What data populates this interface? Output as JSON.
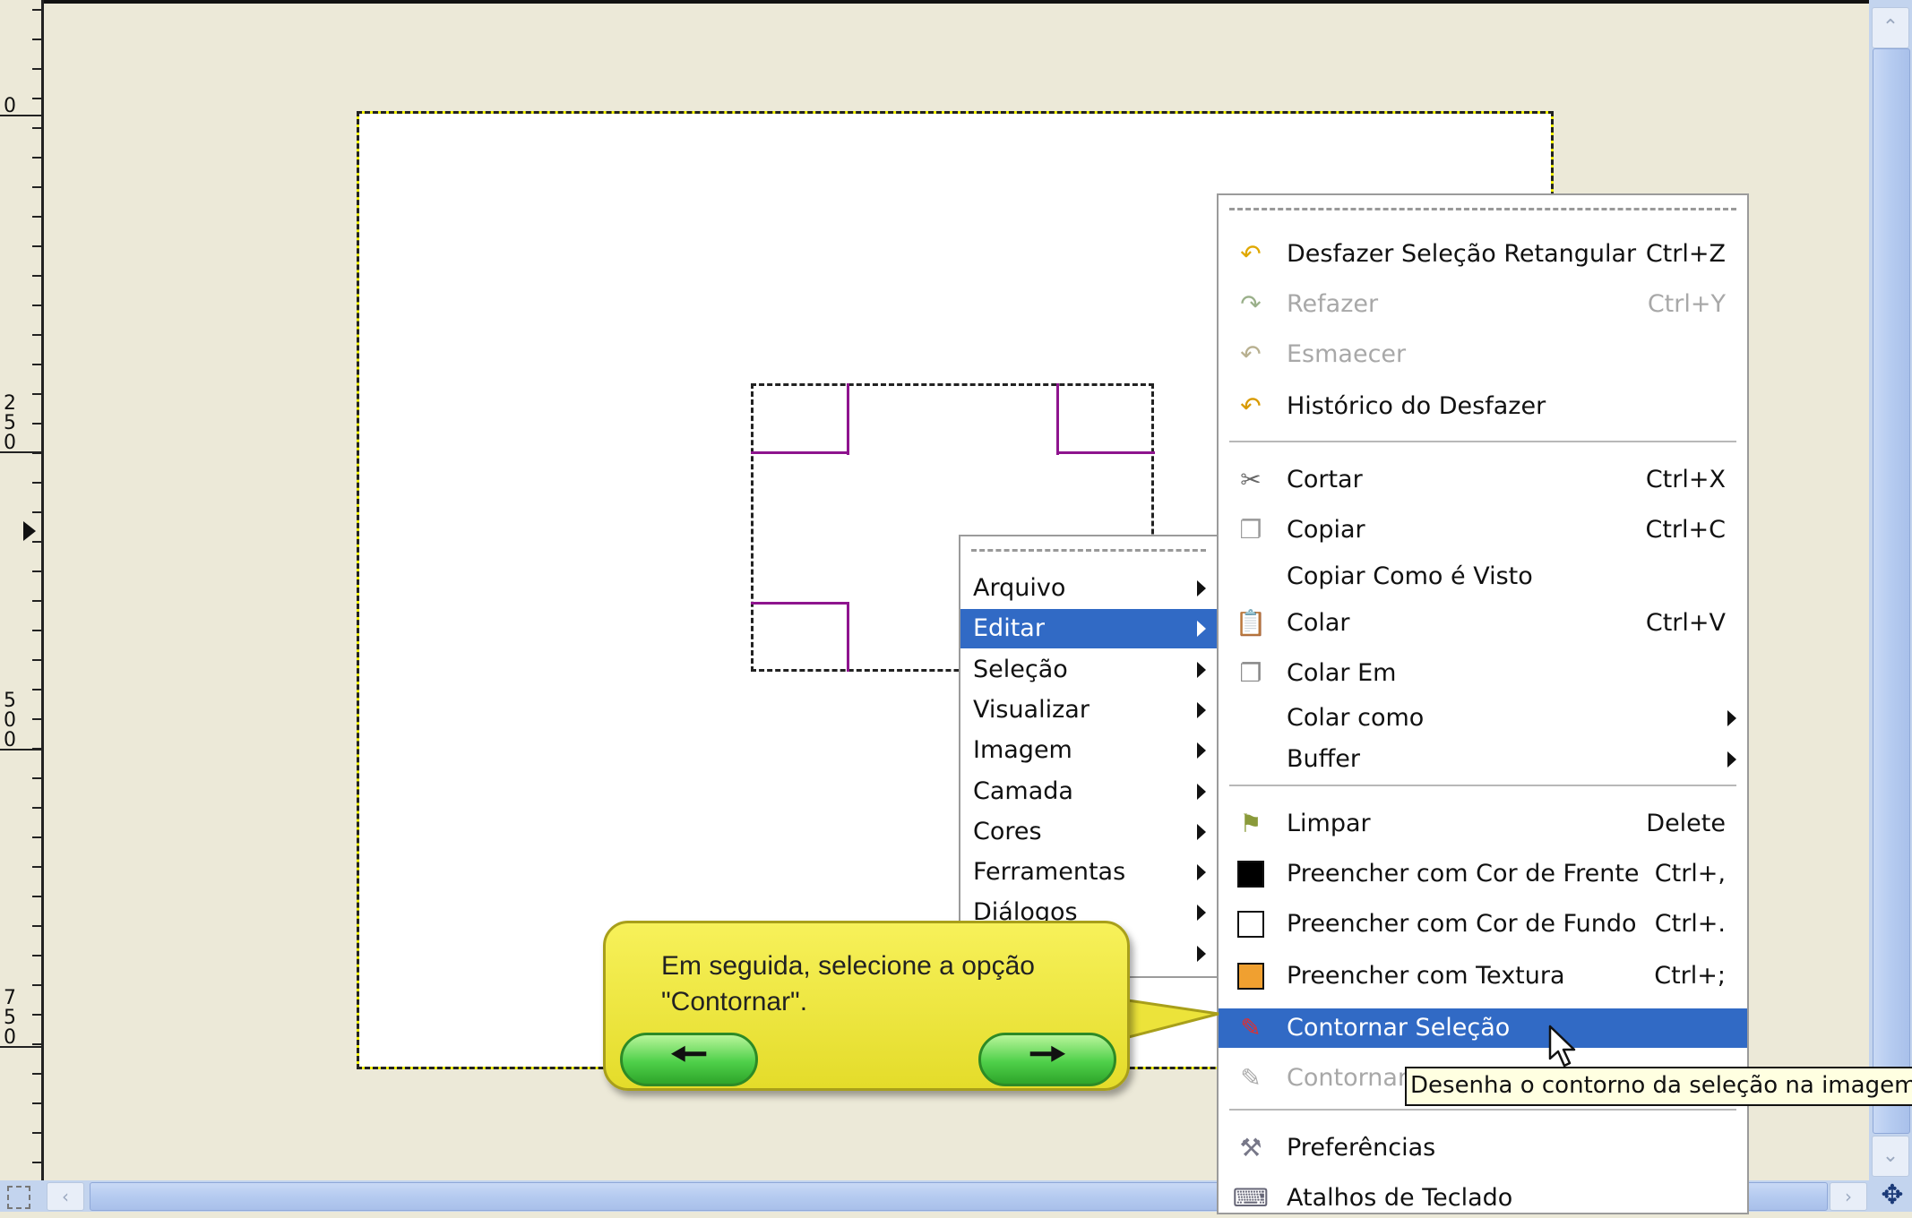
{
  "ruler": {
    "labels": [
      {
        "text": "0",
        "digits": [
          "0"
        ]
      },
      {
        "text": "250",
        "digits": [
          "2",
          "5",
          "0"
        ]
      },
      {
        "text": "500",
        "digits": [
          "5",
          "0",
          "0"
        ]
      },
      {
        "text": "750",
        "digits": [
          "7",
          "5",
          "0"
        ]
      }
    ]
  },
  "main_menu": {
    "items": [
      {
        "label": "Arquivo",
        "has_submenu": true,
        "selected": false
      },
      {
        "label": "Editar",
        "has_submenu": true,
        "selected": true
      },
      {
        "label": "Seleção",
        "has_submenu": true,
        "selected": false
      },
      {
        "label": "Visualizar",
        "has_submenu": true,
        "selected": false
      },
      {
        "label": "Imagem",
        "has_submenu": true,
        "selected": false
      },
      {
        "label": "Camada",
        "has_submenu": true,
        "selected": false
      },
      {
        "label": "Cores",
        "has_submenu": true,
        "selected": false
      },
      {
        "label": "Ferramentas",
        "has_submenu": true,
        "selected": false
      },
      {
        "label": "Diálogos",
        "has_submenu": true,
        "selected": false
      }
    ]
  },
  "edit_menu": {
    "items": [
      {
        "label": "Desfazer Seleção Retangular",
        "shortcut": "Ctrl+Z",
        "icon": "undo-icon",
        "disabled": false
      },
      {
        "label": "Refazer",
        "shortcut": "Ctrl+Y",
        "icon": "redo-icon",
        "disabled": true
      },
      {
        "label": "Esmaecer",
        "shortcut": "",
        "icon": "fade-icon",
        "disabled": true
      },
      {
        "label": "Histórico do Desfazer",
        "shortcut": "",
        "icon": "undo-history-icon",
        "disabled": false
      },
      {
        "label": "Cortar",
        "shortcut": "Ctrl+X",
        "icon": "scissors-icon",
        "disabled": false
      },
      {
        "label": "Copiar",
        "shortcut": "Ctrl+C",
        "icon": "copy-icon",
        "disabled": false
      },
      {
        "label": "Copiar Como é Visto",
        "shortcut": "",
        "icon": "",
        "disabled": false
      },
      {
        "label": "Colar",
        "shortcut": "Ctrl+V",
        "icon": "paste-icon",
        "disabled": false
      },
      {
        "label": "Colar Em",
        "shortcut": "",
        "icon": "paste-into-icon",
        "disabled": false
      },
      {
        "label": "Colar como",
        "shortcut": "",
        "icon": "",
        "disabled": false,
        "has_submenu": true
      },
      {
        "label": "Buffer",
        "shortcut": "",
        "icon": "",
        "disabled": false,
        "has_submenu": true
      },
      {
        "label": "Limpar",
        "shortcut": "Delete",
        "icon": "clear-icon",
        "disabled": false
      },
      {
        "label": "Preencher com Cor de Frente",
        "shortcut": "Ctrl+,",
        "icon": "fill-foreground-icon",
        "disabled": false
      },
      {
        "label": "Preencher com Cor de Fundo",
        "shortcut": "Ctrl+.",
        "icon": "fill-background-icon",
        "disabled": false
      },
      {
        "label": "Preencher com Textura",
        "shortcut": "Ctrl+;",
        "icon": "fill-pattern-icon",
        "disabled": false
      },
      {
        "label": "Contornar Seleção",
        "shortcut": "",
        "icon": "stroke-selection-icon",
        "disabled": false,
        "selected": true
      },
      {
        "label": "Contornar",
        "shortcut": "",
        "icon": "stroke-path-icon",
        "disabled": true
      },
      {
        "label": "Preferências",
        "shortcut": "",
        "icon": "preferences-icon",
        "disabled": false
      },
      {
        "label": "Atalhos de Teclado",
        "shortcut": "",
        "icon": "keyboard-shortcuts-icon",
        "disabled": false
      }
    ]
  },
  "tooltip": {
    "text": "Desenha  o contorno da seleção na imagem"
  },
  "callout": {
    "text": "Em seguida, selecione a opção \"Contornar\".",
    "back_icon": "arrow-left-icon",
    "next_icon": "arrow-right-icon"
  },
  "colors": {
    "menu_highlight": "#316ac5",
    "selection_guide": "#8e148e",
    "callout_fill": "#f2ec48",
    "button_green": "#4fd04a"
  }
}
